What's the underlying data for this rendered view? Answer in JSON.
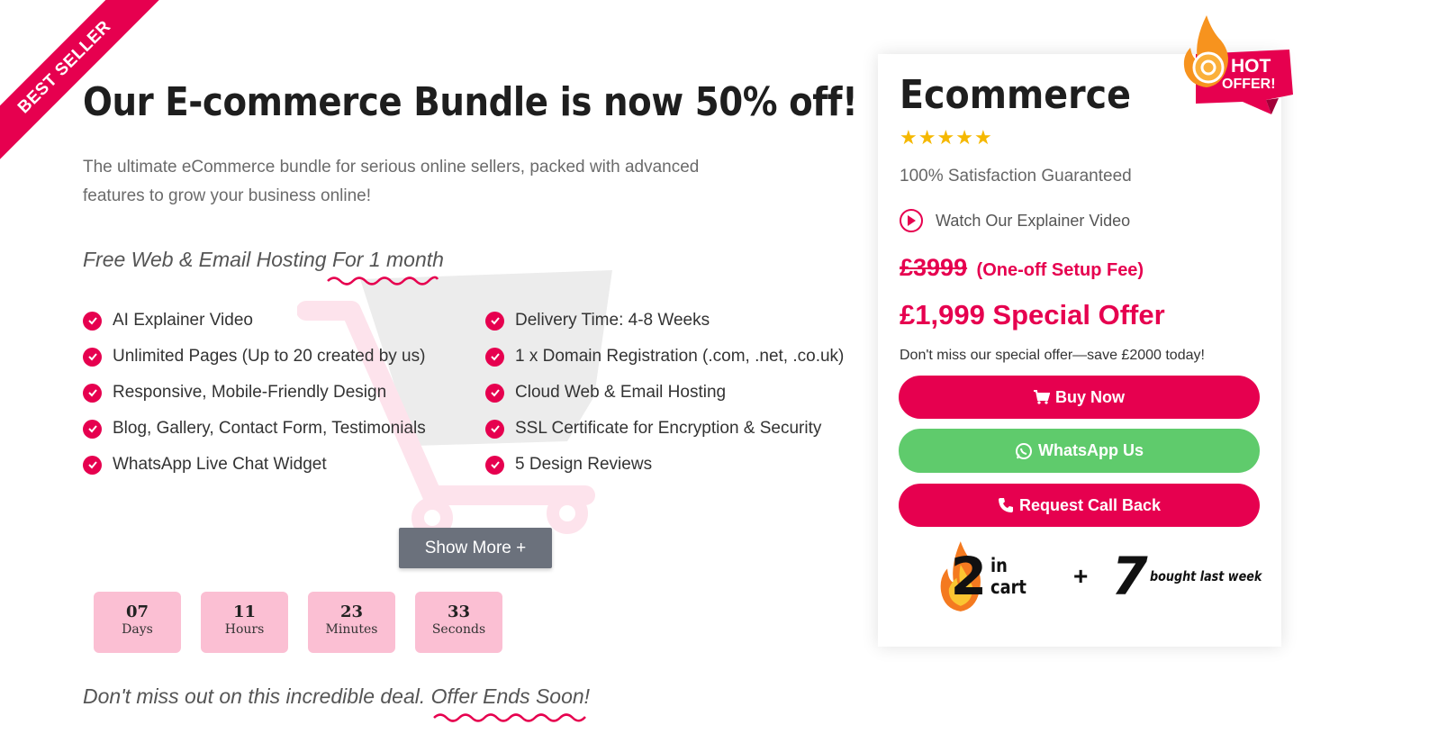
{
  "ribbon": {
    "label": "BEST SELLER"
  },
  "hero": {
    "headline": "Our E-commerce Bundle is now 50% off!",
    "subtitle": "The ultimate eCommerce bundle for serious online sellers, packed with advanced features to grow your business online!",
    "hosting": "Free Web & Email Hosting For 1 month"
  },
  "features": {
    "left": [
      "AI Explainer Video",
      "Unlimited Pages (Up to 20 created by us)",
      "Responsive, Mobile-Friendly Design",
      "Blog, Gallery, Contact Form, Testimonials",
      "WhatsApp Live Chat Widget"
    ],
    "right": [
      "Delivery Time: 4-8 Weeks",
      "1 x Domain Registration (.com, .net, .co.uk)",
      "Cloud Web & Email Hosting",
      "SSL Certificate for Encryption & Security",
      "5 Design Reviews"
    ]
  },
  "show_more": "Show More +",
  "countdown": [
    {
      "value": "07",
      "label": "Days"
    },
    {
      "value": "11",
      "label": "Hours"
    },
    {
      "value": "23",
      "label": "Minutes"
    },
    {
      "value": "33",
      "label": "Seconds"
    }
  ],
  "footer": {
    "text": "Don't miss out on this incredible deal. Offer Ends Soon!"
  },
  "card": {
    "title": "Ecommerce",
    "rating": 5,
    "satisfaction": "100% Satisfaction Guaranteed",
    "video_link": "Watch Our Explainer Video",
    "old_price": "£3999",
    "setup_fee": "(One-off Setup Fee)",
    "special_offer": "£1,999 Special Offer",
    "dont_miss": "Don't miss our special offer—save £2000 today!",
    "buy_label": "Buy Now",
    "whatsapp_label": "WhatsApp Us",
    "callback_label": "Request Call Back",
    "in_cart_count": "2",
    "in_cart_label": "in cart",
    "plus": "+",
    "bought_count": "7",
    "bought_label": "bought last week"
  },
  "badge": {
    "line1": "HOT",
    "line2": "OFFER!"
  },
  "colors": {
    "accent": "#e6004f",
    "whatsapp": "#5fcb6c",
    "countdown_bg": "#fbbfd3",
    "show_more_bg": "#6b717c",
    "star": "#f5b800"
  }
}
